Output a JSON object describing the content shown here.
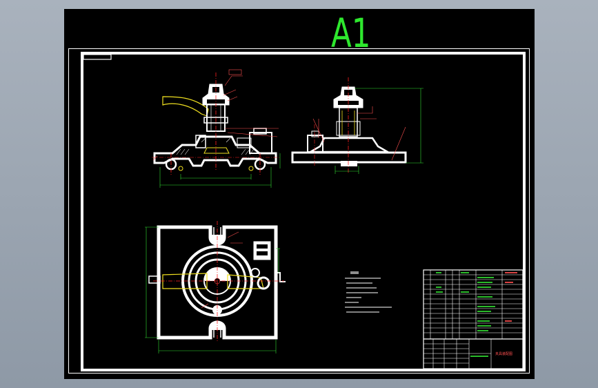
{
  "sheet": {
    "size_label": "A1"
  },
  "colors": {
    "desktop": "#9aa4af",
    "paper": "#000000",
    "outline": "#ffffff",
    "hatch": "#e0e0e0",
    "centerline": "#ff2020",
    "leader": "#ff5050",
    "dimension": "#33dd33",
    "yellow_part": "#f0e020",
    "title_text": "#2ee82e"
  },
  "title_block": {
    "drawing_name": "夹具装配图"
  }
}
